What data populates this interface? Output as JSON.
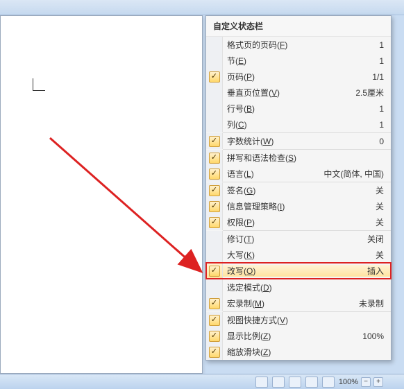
{
  "menu": {
    "title": "自定义状态栏",
    "groups": [
      [
        {
          "checked": false,
          "label": "格式页的页码",
          "key": "F",
          "value": "1"
        },
        {
          "checked": false,
          "label": "节",
          "key": "E",
          "value": "1"
        },
        {
          "checked": true,
          "label": "页码",
          "key": "P",
          "value": "1/1"
        },
        {
          "checked": false,
          "label": "垂直页位置",
          "key": "V",
          "value": "2.5厘米"
        },
        {
          "checked": false,
          "label": "行号",
          "key": "B",
          "value": "1"
        },
        {
          "checked": false,
          "label": "列",
          "key": "C",
          "value": "1"
        }
      ],
      [
        {
          "checked": true,
          "label": "字数统计",
          "key": "W",
          "value": "0"
        }
      ],
      [
        {
          "checked": true,
          "label": "拼写和语法检查",
          "key": "S",
          "value": ""
        },
        {
          "checked": true,
          "label": "语言",
          "key": "L",
          "value": "中文(简体, 中国)"
        }
      ],
      [
        {
          "checked": true,
          "label": "签名",
          "key": "G",
          "value": "关"
        },
        {
          "checked": true,
          "label": "信息管理策略",
          "key": "I",
          "value": "关"
        },
        {
          "checked": true,
          "label": "权限",
          "key": "P",
          "value": "关"
        }
      ],
      [
        {
          "checked": false,
          "label": "修订",
          "key": "T",
          "value": "关闭"
        },
        {
          "checked": false,
          "label": "大写",
          "key": "K",
          "value": "关"
        },
        {
          "checked": true,
          "label": "改写",
          "key": "O",
          "value": "插入",
          "highlight": true
        }
      ],
      [
        {
          "checked": false,
          "label": "选定模式",
          "key": "D",
          "value": ""
        },
        {
          "checked": true,
          "label": "宏录制",
          "key": "M",
          "value": "未录制"
        }
      ],
      [
        {
          "checked": true,
          "label": "视图快捷方式",
          "key": "V",
          "value": ""
        },
        {
          "checked": true,
          "label": "显示比例",
          "key": "Z",
          "value": "100%"
        },
        {
          "checked": true,
          "label": "缩放滑块",
          "key": "Z",
          "value": ""
        }
      ]
    ]
  },
  "statusbar": {
    "zoom": "100%"
  },
  "icons": {
    "check": "✓"
  }
}
